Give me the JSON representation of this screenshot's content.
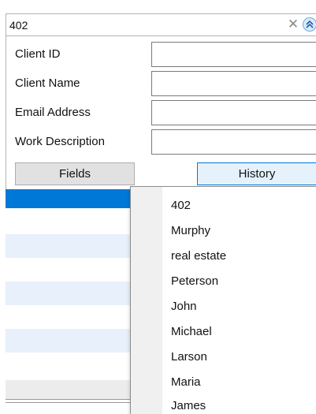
{
  "search": {
    "value": "402",
    "clear_icon": "close-icon",
    "collapse_icon": "double-chevron-up-icon"
  },
  "fields": [
    {
      "label": "Client ID",
      "value": ""
    },
    {
      "label": "Client Name",
      "value": ""
    },
    {
      "label": "Email Address",
      "value": ""
    },
    {
      "label": "Work Description",
      "value": ""
    }
  ],
  "buttons": {
    "fields_label": "Fields",
    "history_label": "History"
  },
  "history_dropdown": {
    "items": [
      "402",
      "Murphy",
      "real estate",
      "Peterson",
      "John",
      "Michael",
      "Larson",
      "Maria",
      "James"
    ]
  },
  "colors": {
    "selection": "#0078d7",
    "alt_row": "#e8f0fb",
    "accent_border": "#0078d7"
  }
}
